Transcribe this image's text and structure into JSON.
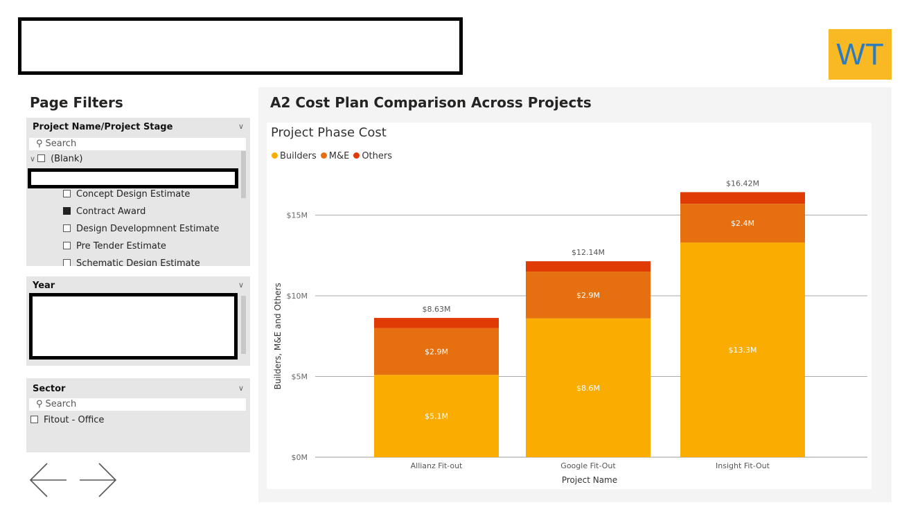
{
  "logo": {
    "text": "WT",
    "bg": "#f9b923",
    "fg": "#2a7bbf"
  },
  "filters": {
    "title": "Page Filters",
    "project_slicer": {
      "header": "Project Name/Project Stage",
      "search_placeholder": "Search",
      "blank_label": "(Blank)",
      "options": [
        {
          "label": "Concept Design Estimate",
          "checked": false
        },
        {
          "label": "Contract Award",
          "checked": true
        },
        {
          "label": "Design Developmnent Estimate",
          "checked": false
        },
        {
          "label": "Pre Tender Estimate",
          "checked": false
        },
        {
          "label": "Schematic Design Estimate",
          "checked": false
        }
      ]
    },
    "year_slicer": {
      "header": "Year"
    },
    "sector_slicer": {
      "header": "Sector",
      "search_placeholder": "Search",
      "options": [
        {
          "label": "Fitout - Office",
          "checked": false
        }
      ]
    }
  },
  "nav": {
    "back_icon": "arrow-left-icon",
    "forward_icon": "arrow-right-icon"
  },
  "main": {
    "title": "A2 Cost Plan Comparison Across Projects"
  },
  "chart_data": {
    "type": "bar",
    "stacked": true,
    "title": "Project Phase Cost",
    "xlabel": "Project Name",
    "ylabel": "Builders, M&E and Others",
    "categories": [
      "Allianz Fit-out",
      "Google Fit-Out",
      "Insight Fit-Out"
    ],
    "series": [
      {
        "name": "Builders",
        "color": "#fbac00",
        "values": [
          5.1,
          8.6,
          13.3
        ],
        "labels": [
          "$5.1M",
          "$8.6M",
          "$13.3M"
        ]
      },
      {
        "name": "M&E",
        "color": "#e6700f",
        "values": [
          2.9,
          2.9,
          2.4
        ],
        "labels": [
          "$2.9M",
          "$2.9M",
          "$2.4M"
        ]
      },
      {
        "name": "Others",
        "color": "#e03a05",
        "values": [
          0.63,
          0.64,
          0.72
        ],
        "labels": [
          "",
          "",
          ""
        ]
      }
    ],
    "totals": [
      "$8.63M",
      "$12.14M",
      "$16.42M"
    ],
    "yticks": [
      {
        "value": 0,
        "label": "$0M"
      },
      {
        "value": 5,
        "label": "$5M"
      },
      {
        "value": 10,
        "label": "$10M"
      },
      {
        "value": 15,
        "label": "$15M"
      }
    ],
    "ylim": [
      0,
      18.5
    ],
    "grid": true,
    "legend_position": "top-left"
  }
}
